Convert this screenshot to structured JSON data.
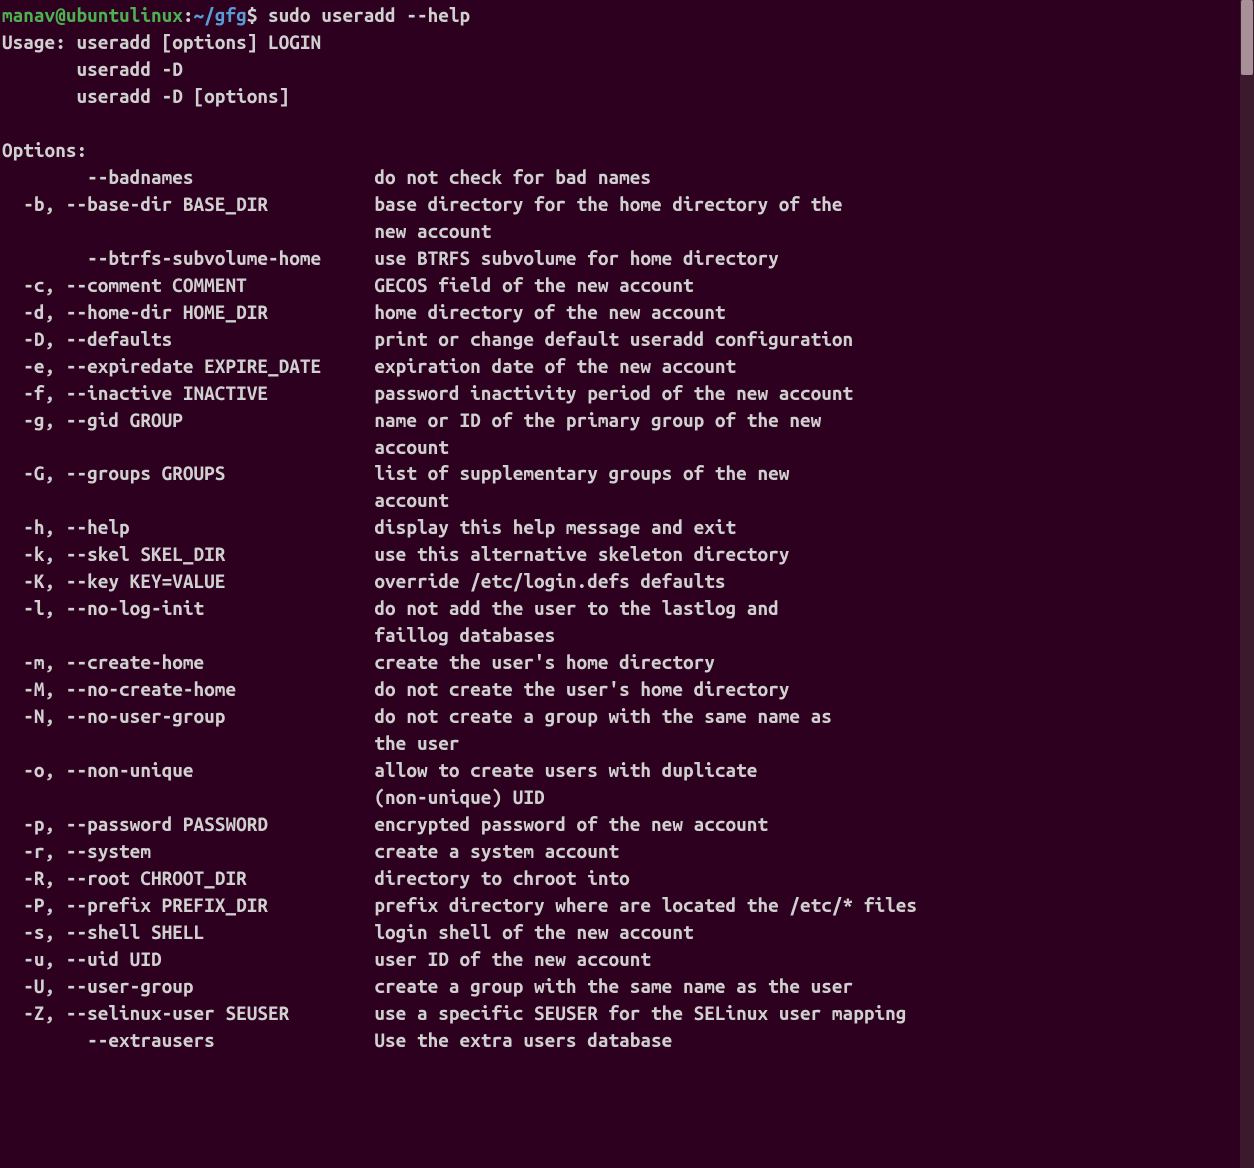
{
  "prompt": {
    "user_host": "manav@ubuntulinux",
    "colon": ":",
    "path": "~/gfg",
    "dollar": "$ "
  },
  "command": "sudo useradd --help",
  "usage_lines": [
    "Usage: useradd [options] LOGIN",
    "       useradd -D",
    "       useradd -D [options]"
  ],
  "options_header": "Options:",
  "options": [
    {
      "short": "",
      "long": "      --badnames",
      "desc": [
        "do not check for bad names"
      ]
    },
    {
      "short": "-b,",
      "long": " --base-dir BASE_DIR",
      "desc": [
        "base directory for the home directory of the",
        "new account"
      ]
    },
    {
      "short": "",
      "long": "      --btrfs-subvolume-home",
      "desc": [
        "use BTRFS subvolume for home directory"
      ]
    },
    {
      "short": "-c,",
      "long": " --comment COMMENT",
      "desc": [
        "GECOS field of the new account"
      ]
    },
    {
      "short": "-d,",
      "long": " --home-dir HOME_DIR",
      "desc": [
        "home directory of the new account"
      ]
    },
    {
      "short": "-D,",
      "long": " --defaults",
      "desc": [
        "print or change default useradd configuration"
      ]
    },
    {
      "short": "-e,",
      "long": " --expiredate EXPIRE_DATE",
      "desc": [
        "expiration date of the new account"
      ]
    },
    {
      "short": "-f,",
      "long": " --inactive INACTIVE",
      "desc": [
        "password inactivity period of the new account"
      ]
    },
    {
      "short": "-g,",
      "long": " --gid GROUP",
      "desc": [
        "name or ID of the primary group of the new",
        "account"
      ]
    },
    {
      "short": "-G,",
      "long": " --groups GROUPS",
      "desc": [
        "list of supplementary groups of the new",
        "account"
      ]
    },
    {
      "short": "-h,",
      "long": " --help",
      "desc": [
        "display this help message and exit"
      ]
    },
    {
      "short": "-k,",
      "long": " --skel SKEL_DIR",
      "desc": [
        "use this alternative skeleton directory"
      ]
    },
    {
      "short": "-K,",
      "long": " --key KEY=VALUE",
      "desc": [
        "override /etc/login.defs defaults"
      ]
    },
    {
      "short": "-l,",
      "long": " --no-log-init",
      "desc": [
        "do not add the user to the lastlog and",
        "faillog databases"
      ]
    },
    {
      "short": "-m,",
      "long": " --create-home",
      "desc": [
        "create the user's home directory"
      ]
    },
    {
      "short": "-M,",
      "long": " --no-create-home",
      "desc": [
        "do not create the user's home directory"
      ]
    },
    {
      "short": "-N,",
      "long": " --no-user-group",
      "desc": [
        "do not create a group with the same name as",
        "the user"
      ]
    },
    {
      "short": "-o,",
      "long": " --non-unique",
      "desc": [
        "allow to create users with duplicate",
        "(non-unique) UID"
      ]
    },
    {
      "short": "-p,",
      "long": " --password PASSWORD",
      "desc": [
        "encrypted password of the new account"
      ]
    },
    {
      "short": "-r,",
      "long": " --system",
      "desc": [
        "create a system account"
      ]
    },
    {
      "short": "-R,",
      "long": " --root CHROOT_DIR",
      "desc": [
        "directory to chroot into"
      ]
    },
    {
      "short": "-P,",
      "long": " --prefix PREFIX_DIR",
      "desc": [
        "prefix directory where are located the /etc/* files"
      ]
    },
    {
      "short": "-s,",
      "long": " --shell SHELL",
      "desc": [
        "login shell of the new account"
      ]
    },
    {
      "short": "-u,",
      "long": " --uid UID",
      "desc": [
        "user ID of the new account"
      ]
    },
    {
      "short": "-U,",
      "long": " --user-group",
      "desc": [
        "create a group with the same name as the user"
      ]
    },
    {
      "short": "-Z,",
      "long": " --selinux-user SEUSER",
      "desc": [
        "use a specific SEUSER for the SELinux user mapping"
      ]
    },
    {
      "short": "",
      "long": "      --extrausers",
      "desc": [
        "Use the extra users database"
      ]
    }
  ],
  "layout": {
    "flag_col_width": 33,
    "indent": "  "
  }
}
